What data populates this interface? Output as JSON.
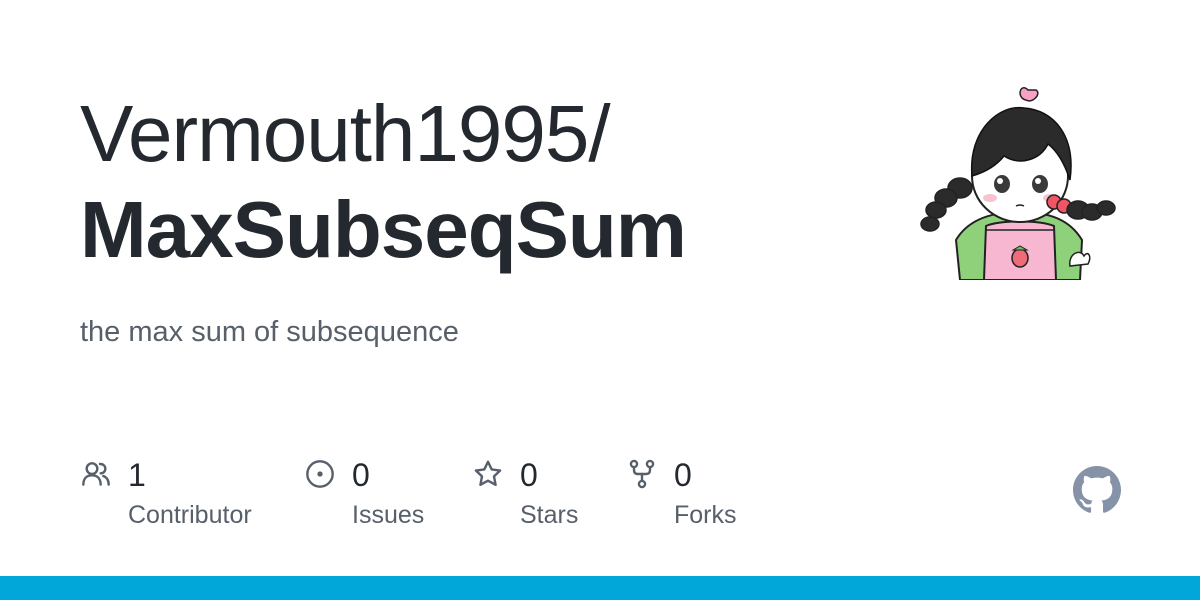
{
  "repo": {
    "owner": "Vermouth1995/",
    "name": "MaxSubseqSum",
    "description": "the max sum of subsequence"
  },
  "stats": {
    "contributors": {
      "value": "1",
      "label": "Contributor",
      "icon": "people-icon"
    },
    "issues": {
      "value": "0",
      "label": "Issues",
      "icon": "issue-opened-icon"
    },
    "stars": {
      "value": "0",
      "label": "Stars",
      "icon": "star-icon"
    },
    "forks": {
      "value": "0",
      "label": "Forks",
      "icon": "repo-forked-icon"
    }
  },
  "brand": {
    "mark": "github-mark-icon",
    "bar_color": "#00a7d8",
    "icon_color": "#57606a",
    "mark_color": "#8592a8"
  },
  "avatar": {
    "icon": "avatar-illustration"
  }
}
